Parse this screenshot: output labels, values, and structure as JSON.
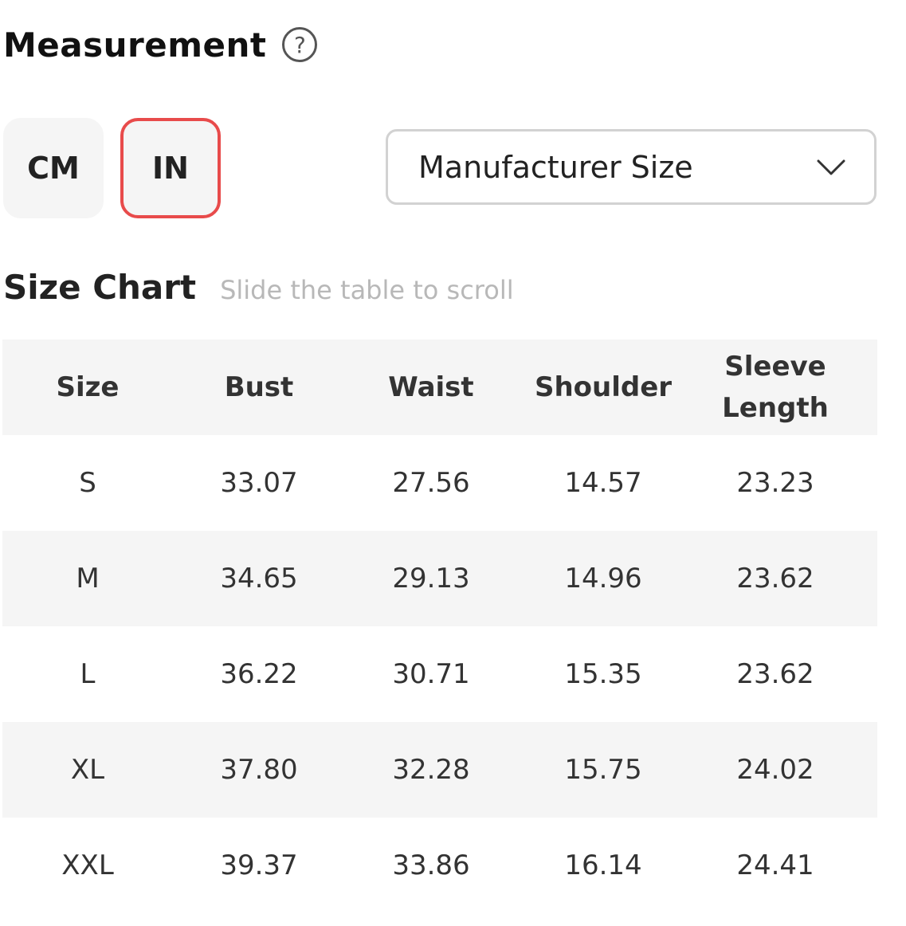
{
  "header": {
    "title": "Measurement",
    "help_symbol": "?"
  },
  "units": {
    "cm_label": "CM",
    "in_label": "IN",
    "selected": "IN",
    "accent_color": "#e84b4b"
  },
  "size_select": {
    "value": "Manufacturer Size",
    "icon": "chevron-down-icon"
  },
  "size_chart": {
    "title": "Size Chart",
    "hint": "Slide the table to scroll",
    "columns": [
      "Size",
      "Bust",
      "Waist",
      "Shoulder",
      "Sleeve Length"
    ],
    "rows": [
      [
        "S",
        "33.07",
        "27.56",
        "14.57",
        "23.23"
      ],
      [
        "M",
        "34.65",
        "29.13",
        "14.96",
        "23.62"
      ],
      [
        "L",
        "36.22",
        "30.71",
        "15.35",
        "23.62"
      ],
      [
        "XL",
        "37.80",
        "32.28",
        "15.75",
        "24.02"
      ],
      [
        "XXL",
        "39.37",
        "33.86",
        "16.14",
        "24.41"
      ]
    ]
  }
}
